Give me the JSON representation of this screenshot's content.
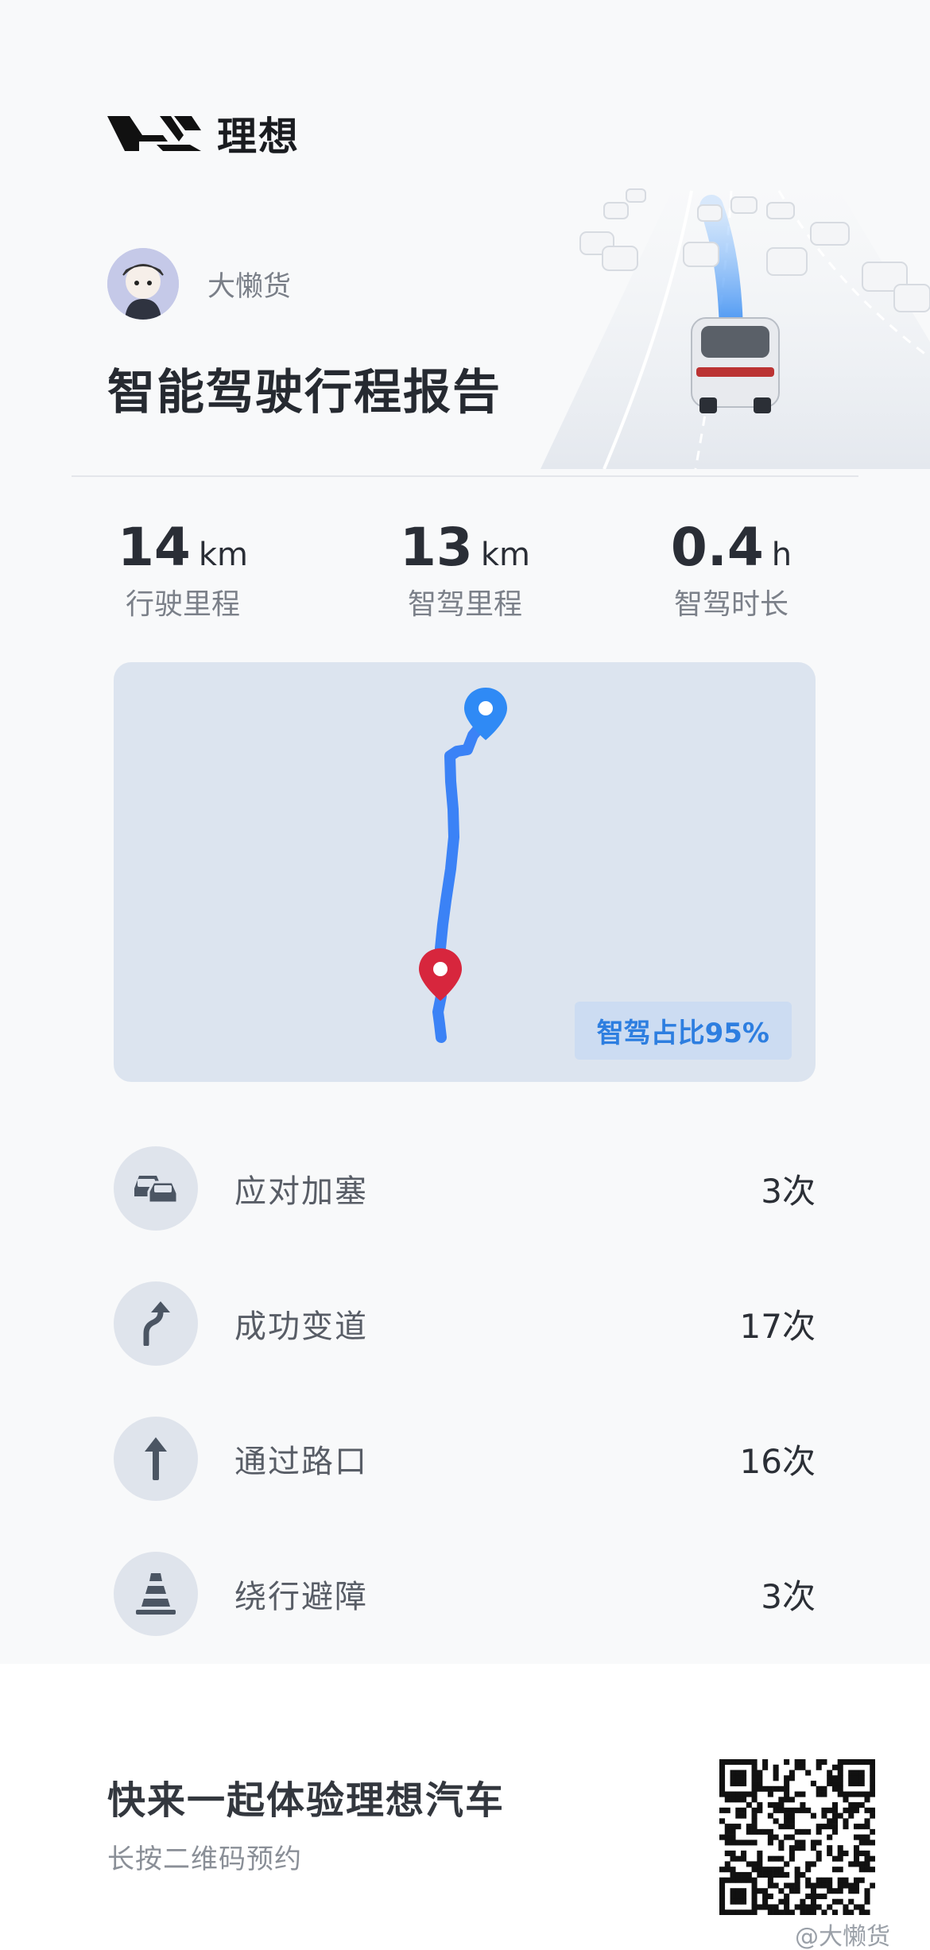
{
  "brand": {
    "name": "理想"
  },
  "user": {
    "name": "大懒货"
  },
  "report": {
    "title": "智能驾驶行程报告"
  },
  "stats": [
    {
      "value": "14",
      "unit": "km",
      "label": "行驶里程"
    },
    {
      "value": "13",
      "unit": "km",
      "label": "智驾里程"
    },
    {
      "value": "0.4",
      "unit": "h",
      "label": "智驾时长"
    }
  ],
  "map": {
    "ratio_label": "智驾占比95%",
    "route_color": "#3b82f6",
    "start_color": "#2f8af5",
    "end_color": "#d7263d"
  },
  "events": [
    {
      "icon": "traffic-jam-icon",
      "label": "应对加塞",
      "count": "3次"
    },
    {
      "icon": "lane-change-icon",
      "label": "成功变道",
      "count": "17次"
    },
    {
      "icon": "intersection-icon",
      "label": "通过路口",
      "count": "16次"
    },
    {
      "icon": "obstacle-cone-icon",
      "label": "绕行避障",
      "count": "3次"
    }
  ],
  "footer": {
    "cta": "快来一起体验理想汽车",
    "sub": "长按二维码预约",
    "watermark": "@大懒货"
  }
}
